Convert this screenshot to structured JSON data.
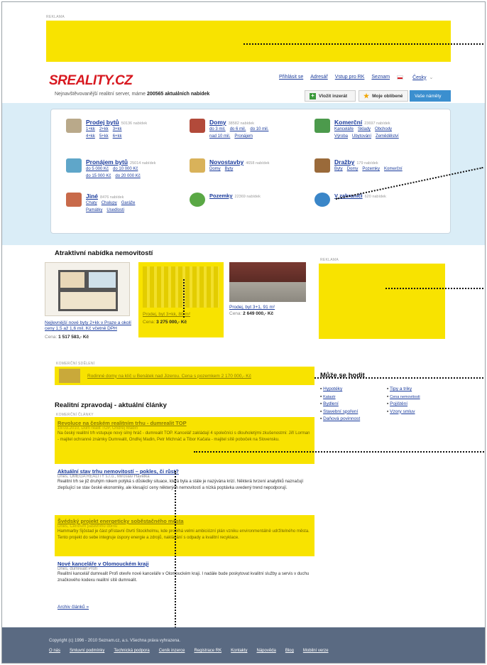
{
  "top_ad": {
    "label": "REKLAMA"
  },
  "header": {
    "logo": "SREALITY.CZ",
    "subtitle_prefix": "Nejnavštěvovanější realitní server, máme",
    "offer_count": "200565",
    "subtitle_suffix": "aktuálních nabídek",
    "nav": [
      "Přihlásit se",
      "Adresář",
      "Vstup pro RK",
      "Seznam",
      "Česky"
    ],
    "buttons": {
      "insert": "Vložit inzerát",
      "favorites": "Moje oblíbené",
      "ideas": "Vaše náměty"
    }
  },
  "categories": [
    {
      "title": "Prodej bytů",
      "count": "50136 nabídek",
      "links": [
        "1+kk",
        "2+kk",
        "3+kk",
        "4+kk",
        "5+kk",
        "6+kk"
      ]
    },
    {
      "title": "Domy",
      "count": "38582 nabídek",
      "links": [
        "do 3 mil.",
        "do 6 mil.",
        "do 10 mil.",
        "nad 10 mil.",
        "Pronájem"
      ]
    },
    {
      "title": "Komerční",
      "count": "23697 nabídek",
      "links": [
        "Kanceláře",
        "Sklady",
        "Obchody",
        "Výroba",
        "Ubytování",
        "Zemědělství"
      ]
    },
    {
      "title": "Pronájem bytů",
      "count": "25014 nabídek",
      "links": [
        "do 5 000 Kč",
        "do 10 000 Kč",
        "do 15 000 Kč",
        "do 20 000 Kč"
      ]
    },
    {
      "title": "Novostavby",
      "count": "4658 nabídek",
      "links": [
        "Domy",
        "Byty"
      ]
    },
    {
      "title": "Dražby",
      "count": "179 nabídek",
      "links": [
        "Byty",
        "Domy",
        "Pozemky",
        "Komerční"
      ]
    },
    {
      "title": "Jiné",
      "count": "8476 nabídek",
      "links": [
        "Chaty",
        "Chalupy",
        "Garáže",
        "Památky",
        "Usedlosti"
      ]
    },
    {
      "title": "Pozemky",
      "count": "22369 nabídek",
      "links": []
    },
    {
      "title": "V zahraničí",
      "count": "620 nabídek",
      "links": []
    }
  ],
  "offers": {
    "heading": "Atraktivní nabídka nemovitostí",
    "items": [
      {
        "title": "Nejlevnější nové byty 2+kk v Praze a okolí ceny 1,5 až 1,6 mil. Kč včetně DPH",
        "price_label": "Cena:",
        "price": "1 517 583,- Kč"
      },
      {
        "title": "Prodej, byt 3+kk, 80 m²",
        "price_label": "Cena:",
        "price": "3 275 000,- Kč"
      },
      {
        "title": "Prodej, byt 3+1, 91 m²",
        "price_label": "Cena:",
        "price": "2 649 000,- Kč"
      }
    ],
    "sponsored_label": "KOMERČNÍ SDĚLENÍ",
    "sponsored_text": "Rodinné domy na klíč u Benátek nad Jizerou. Cena s pozemkem 2 170 000,- Kč"
  },
  "side_ad": {
    "label": "REKLAMA"
  },
  "useful": {
    "heading": "Může se hodit",
    "col1": [
      "Hypotéky",
      "Katastr",
      "Bydlení",
      "Stavební spoření",
      "Daňová povinnost"
    ],
    "col2": [
      "Tipy a triky",
      "Cena nemovitosti",
      "Pojištění",
      "Vzory smluv"
    ]
  },
  "news": {
    "heading": "Realitní zpravodaj - aktuální články",
    "commercial_label": "KOMERČNÍ ČLÁNKY",
    "articles": [
      {
        "title": "Revoluce na českém realitním trhu - dumrealit TOP",
        "meta": "19.03.2010, Dům realit TOP, Ondřej Madin",
        "text": "Na český realitní trh vstupuje nový silný hráč - dumrealit TOP. Kancelář zakládají 4 společníci s dlouholetými zkušenostmi: Jiří Lorman - majitel ochranné známky Dumrealit, Ondřej Madin, Petr Michnáč a Tibor Kačala - majitel sítě poboček na Slovensku."
      },
      {
        "title": "Aktuální stav trhu nemovitostí – pokles, či růst?",
        "meta": "Dnes, OMEGA REALITY s.r.o., Miroslav Havelka",
        "text": "Realitní trh se již druhým rokem potýká s důsledky situace, která byla a stále je nazývána krizí. Některá tvrzení analytiků naznačují zlepšující se stav české ekonomiky, ale klesající ceny některých nemovitostí a nízká poptávka uvedený trend nepodporují."
      },
      {
        "title": "Švédský projekt energeticky soběstačného města",
        "meta": "Dnes, Centrum pasivního domu",
        "text": "Hammarby Sjöstad je část přístavní čtvrti Stockholmu, kde probíhá velmi ambiciózní plán vzniku environmentálně udržitelného města. Tento projekt do sebe integruje úspory energie a zdrojů, nakládání s odpady a kvalitní recyklace."
      },
      {
        "title": "Nové kanceláře v Olomouckém kraji",
        "meta": "Dnes, dumrealit Profi",
        "text": "Realitní kancelář dumrealit Profi otevře nové kanceláře v Olomouckém kraji. I nadále bude poskytovat kvalitní služby a servis v duchu značkového kodexu realitní sítě dumrealit."
      }
    ],
    "archive": "Archiv článků »"
  },
  "footer": {
    "copyright": "Copyright (c) 1996 - 2010 Seznam.cz, a.s. Všechna práva vyhrazena.",
    "links": [
      "O nás",
      "Smluvní podmínky",
      "Technická podpora",
      "Ceník inzerce",
      "Registrace RK",
      "Kontakty",
      "Nápověda",
      "Blog",
      "Mobilní verze"
    ]
  },
  "colors": {
    "ad_yellow": "#f8e300",
    "link": "#1a3b9c",
    "logo_red": "#d81920",
    "footer_bg": "#5a6a82",
    "category_band": "#daedf7"
  }
}
